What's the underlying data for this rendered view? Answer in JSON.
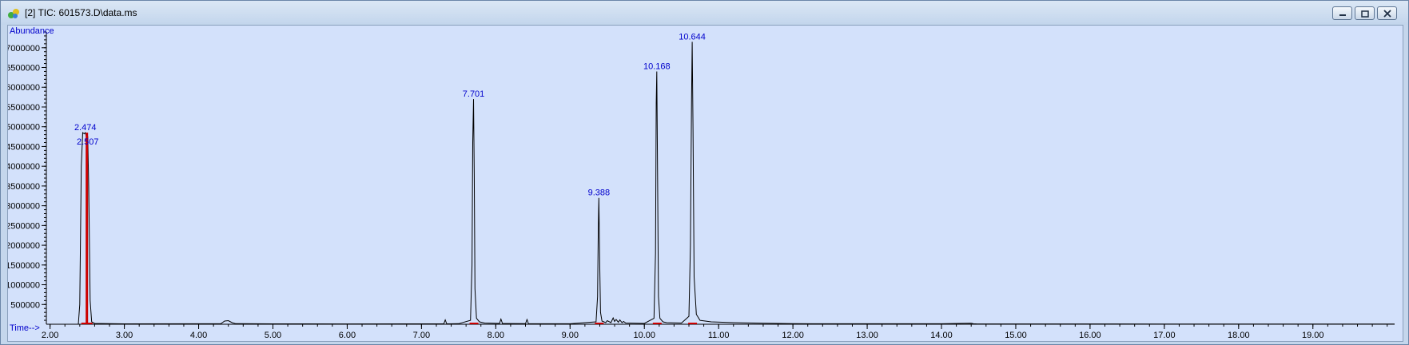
{
  "window": {
    "title": "[2] TIC: 601573.D\\data.ms",
    "icon": "chromatogram-app-icon",
    "controls": [
      "minimize",
      "restore",
      "close"
    ]
  },
  "colors": {
    "trace": "#000000",
    "peak_labels": "#0000cc",
    "axis_labels": "#0000cc",
    "baseline_markers": "#cc0000",
    "plot_background": "#d3e1fb"
  },
  "chart_data": {
    "type": "line",
    "title": "",
    "xlabel": "Time-->",
    "ylabel": "Abundance",
    "xlim": [
      1.95,
      20.1
    ],
    "ylim": [
      0,
      7400000
    ],
    "x_ticks": [
      2,
      3,
      4,
      5,
      6,
      7,
      8,
      9,
      10,
      11,
      12,
      13,
      14,
      15,
      16,
      17,
      18,
      19
    ],
    "x_tick_labels": [
      "2.00",
      "3.00",
      "4.00",
      "5.00",
      "6.00",
      "7.00",
      "8.00",
      "9.00",
      "10.00",
      "11.00",
      "12.00",
      "13.00",
      "14.00",
      "15.00",
      "16.00",
      "17.00",
      "18.00",
      "19.00"
    ],
    "y_ticks": [
      500000,
      1000000,
      1500000,
      2000000,
      2500000,
      3000000,
      3500000,
      4000000,
      4500000,
      5000000,
      5500000,
      6000000,
      6500000,
      7000000
    ],
    "y_tick_labels": [
      "500000",
      "1000000",
      "1500000",
      "2000000",
      "2500000",
      "3000000",
      "3500000",
      "4000000",
      "4500000",
      "5000000",
      "5500000",
      "6000000",
      "6500000",
      "7000000"
    ],
    "grid": false,
    "peaks": [
      {
        "label": "2.474",
        "x": 2.474,
        "y": 4850000
      },
      {
        "label": "2.507",
        "x": 2.507,
        "y": 4750000
      },
      {
        "label": "7.701",
        "x": 7.701,
        "y": 5700000
      },
      {
        "label": "9.388",
        "x": 9.388,
        "y": 3200000
      },
      {
        "label": "10.168",
        "x": 10.168,
        "y": 6400000
      },
      {
        "label": "10.644",
        "x": 10.644,
        "y": 7150000
      }
    ],
    "series": [
      {
        "x": [
          1.95,
          2.38,
          2.4,
          2.42,
          2.44,
          2.46,
          2.474,
          2.49,
          2.507,
          2.52,
          2.54,
          2.56,
          2.6,
          3.0,
          4.3,
          4.35,
          4.4,
          4.45,
          4.5,
          5.0,
          6.0,
          7.0,
          7.3,
          7.32,
          7.34,
          7.5,
          7.66,
          7.68,
          7.69,
          7.701,
          7.71,
          7.72,
          7.74,
          7.78,
          7.85,
          8.05,
          8.07,
          8.09,
          8.4,
          8.42,
          8.44,
          9.0,
          9.35,
          9.37,
          9.38,
          9.388,
          9.4,
          9.41,
          9.43,
          9.48,
          9.5,
          9.55,
          9.58,
          9.6,
          9.62,
          9.65,
          9.67,
          9.7,
          9.72,
          9.75,
          10.0,
          10.13,
          10.15,
          10.16,
          10.168,
          10.18,
          10.19,
          10.21,
          10.25,
          10.3,
          10.5,
          10.6,
          10.62,
          10.635,
          10.644,
          10.655,
          10.67,
          10.7,
          10.75,
          10.9,
          11.2,
          11.6,
          12.0,
          14.0,
          14.4,
          14.43,
          14.47,
          15.0,
          17.0,
          20.1
        ],
        "y": [
          0,
          0,
          500000,
          4000000,
          4850000,
          4820000,
          4850000,
          4750000,
          4750000,
          3500000,
          600000,
          60000,
          20000,
          10000,
          15000,
          80000,
          90000,
          40000,
          15000,
          10000,
          8000,
          10000,
          10000,
          110000,
          10000,
          15000,
          100000,
          1500000,
          4600000,
          5700000,
          3800000,
          900000,
          150000,
          60000,
          30000,
          20000,
          130000,
          20000,
          15000,
          120000,
          15000,
          12000,
          60000,
          700000,
          2400000,
          3200000,
          1400000,
          300000,
          80000,
          40000,
          90000,
          40000,
          160000,
          70000,
          120000,
          50000,
          110000,
          40000,
          70000,
          30000,
          20000,
          150000,
          1800000,
          5600000,
          6400000,
          3200000,
          700000,
          150000,
          60000,
          40000,
          30000,
          200000,
          2000000,
          5700000,
          7150000,
          5000000,
          1200000,
          250000,
          100000,
          60000,
          40000,
          25000,
          15000,
          12000,
          25000,
          12000,
          10000,
          8000,
          6000,
          5000
        ]
      }
    ]
  }
}
